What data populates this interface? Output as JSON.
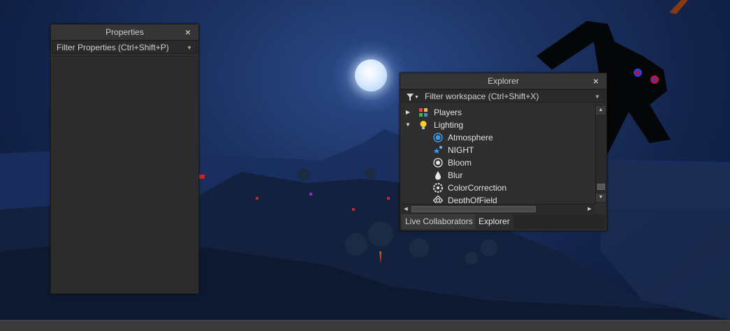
{
  "properties_panel": {
    "title": "Properties",
    "close_icon": "×",
    "filter_placeholder": "Filter Properties (Ctrl+Shift+P)",
    "dropdown_icon": "▼"
  },
  "explorer_panel": {
    "title": "Explorer",
    "close_icon": "×",
    "filter_icon": "funnel-icon",
    "filter_placeholder": "Filter workspace (Ctrl+Shift+X)",
    "dropdown_icon": "▼",
    "tree": [
      {
        "label": "Players",
        "icon": "players-icon",
        "expander": "▶"
      },
      {
        "label": "Lighting",
        "icon": "lightbulb-icon",
        "expander": "▼"
      },
      {
        "label": "Atmosphere",
        "icon": "atmosphere-icon"
      },
      {
        "label": "NIGHT",
        "icon": "sky-icon"
      },
      {
        "label": "Bloom",
        "icon": "bloom-icon"
      },
      {
        "label": "Blur",
        "icon": "blur-icon"
      },
      {
        "label": "ColorCorrection",
        "icon": "color-correction-icon"
      },
      {
        "label": "DepthOfField",
        "icon": "depth-of-field-icon"
      }
    ],
    "tabs": [
      "Live Collaborators",
      "Explorer"
    ],
    "scroll": {
      "up": "▲",
      "down": "▼",
      "left": "◀",
      "right": "▶"
    }
  },
  "colors": {
    "panel_bg": "#2e2e2e",
    "sky": "#122349",
    "accent_blue": "#3b9be8"
  }
}
